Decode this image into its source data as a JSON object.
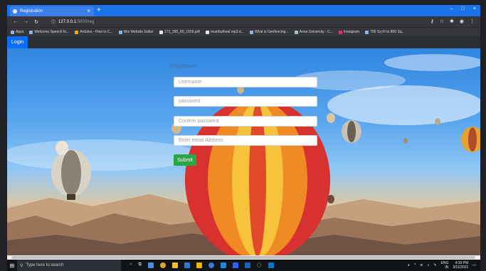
{
  "browser": {
    "tab_title": "Registration",
    "tab_close": "×",
    "new_tab": "+",
    "window_controls": [
      "–",
      "□",
      "×"
    ],
    "url_host": "127.0.0.1",
    "url_path": ":5000/reg",
    "bookmarks": [
      "Apps",
      "Welcome Speech fo...",
      "Arduino - How to C...",
      "Wix Website Editor",
      "173_395_80_1556.pdf",
      "mumbutheal mp3 d...",
      "What is Geofencing...",
      "Anna University - C...",
      "Instagram",
      "700 Sq Ft to 800 Sq..."
    ]
  },
  "page_nav": {
    "login_label": "Login"
  },
  "form": {
    "title": "Registration",
    "username_placeholder": "Username",
    "password_placeholder": "password",
    "confirm_placeholder": "Confirm password",
    "email_placeholder": "Enter email Address",
    "submit_label": "Submit"
  },
  "taskbar": {
    "search_placeholder": "Type here to search",
    "language": "ENG",
    "region": "IN",
    "time": "4:39 PM",
    "date": "3/11/2021"
  },
  "colors": {
    "primary": "#0d6efd",
    "success": "#28a745",
    "browser_accent": "#1a73e8"
  }
}
